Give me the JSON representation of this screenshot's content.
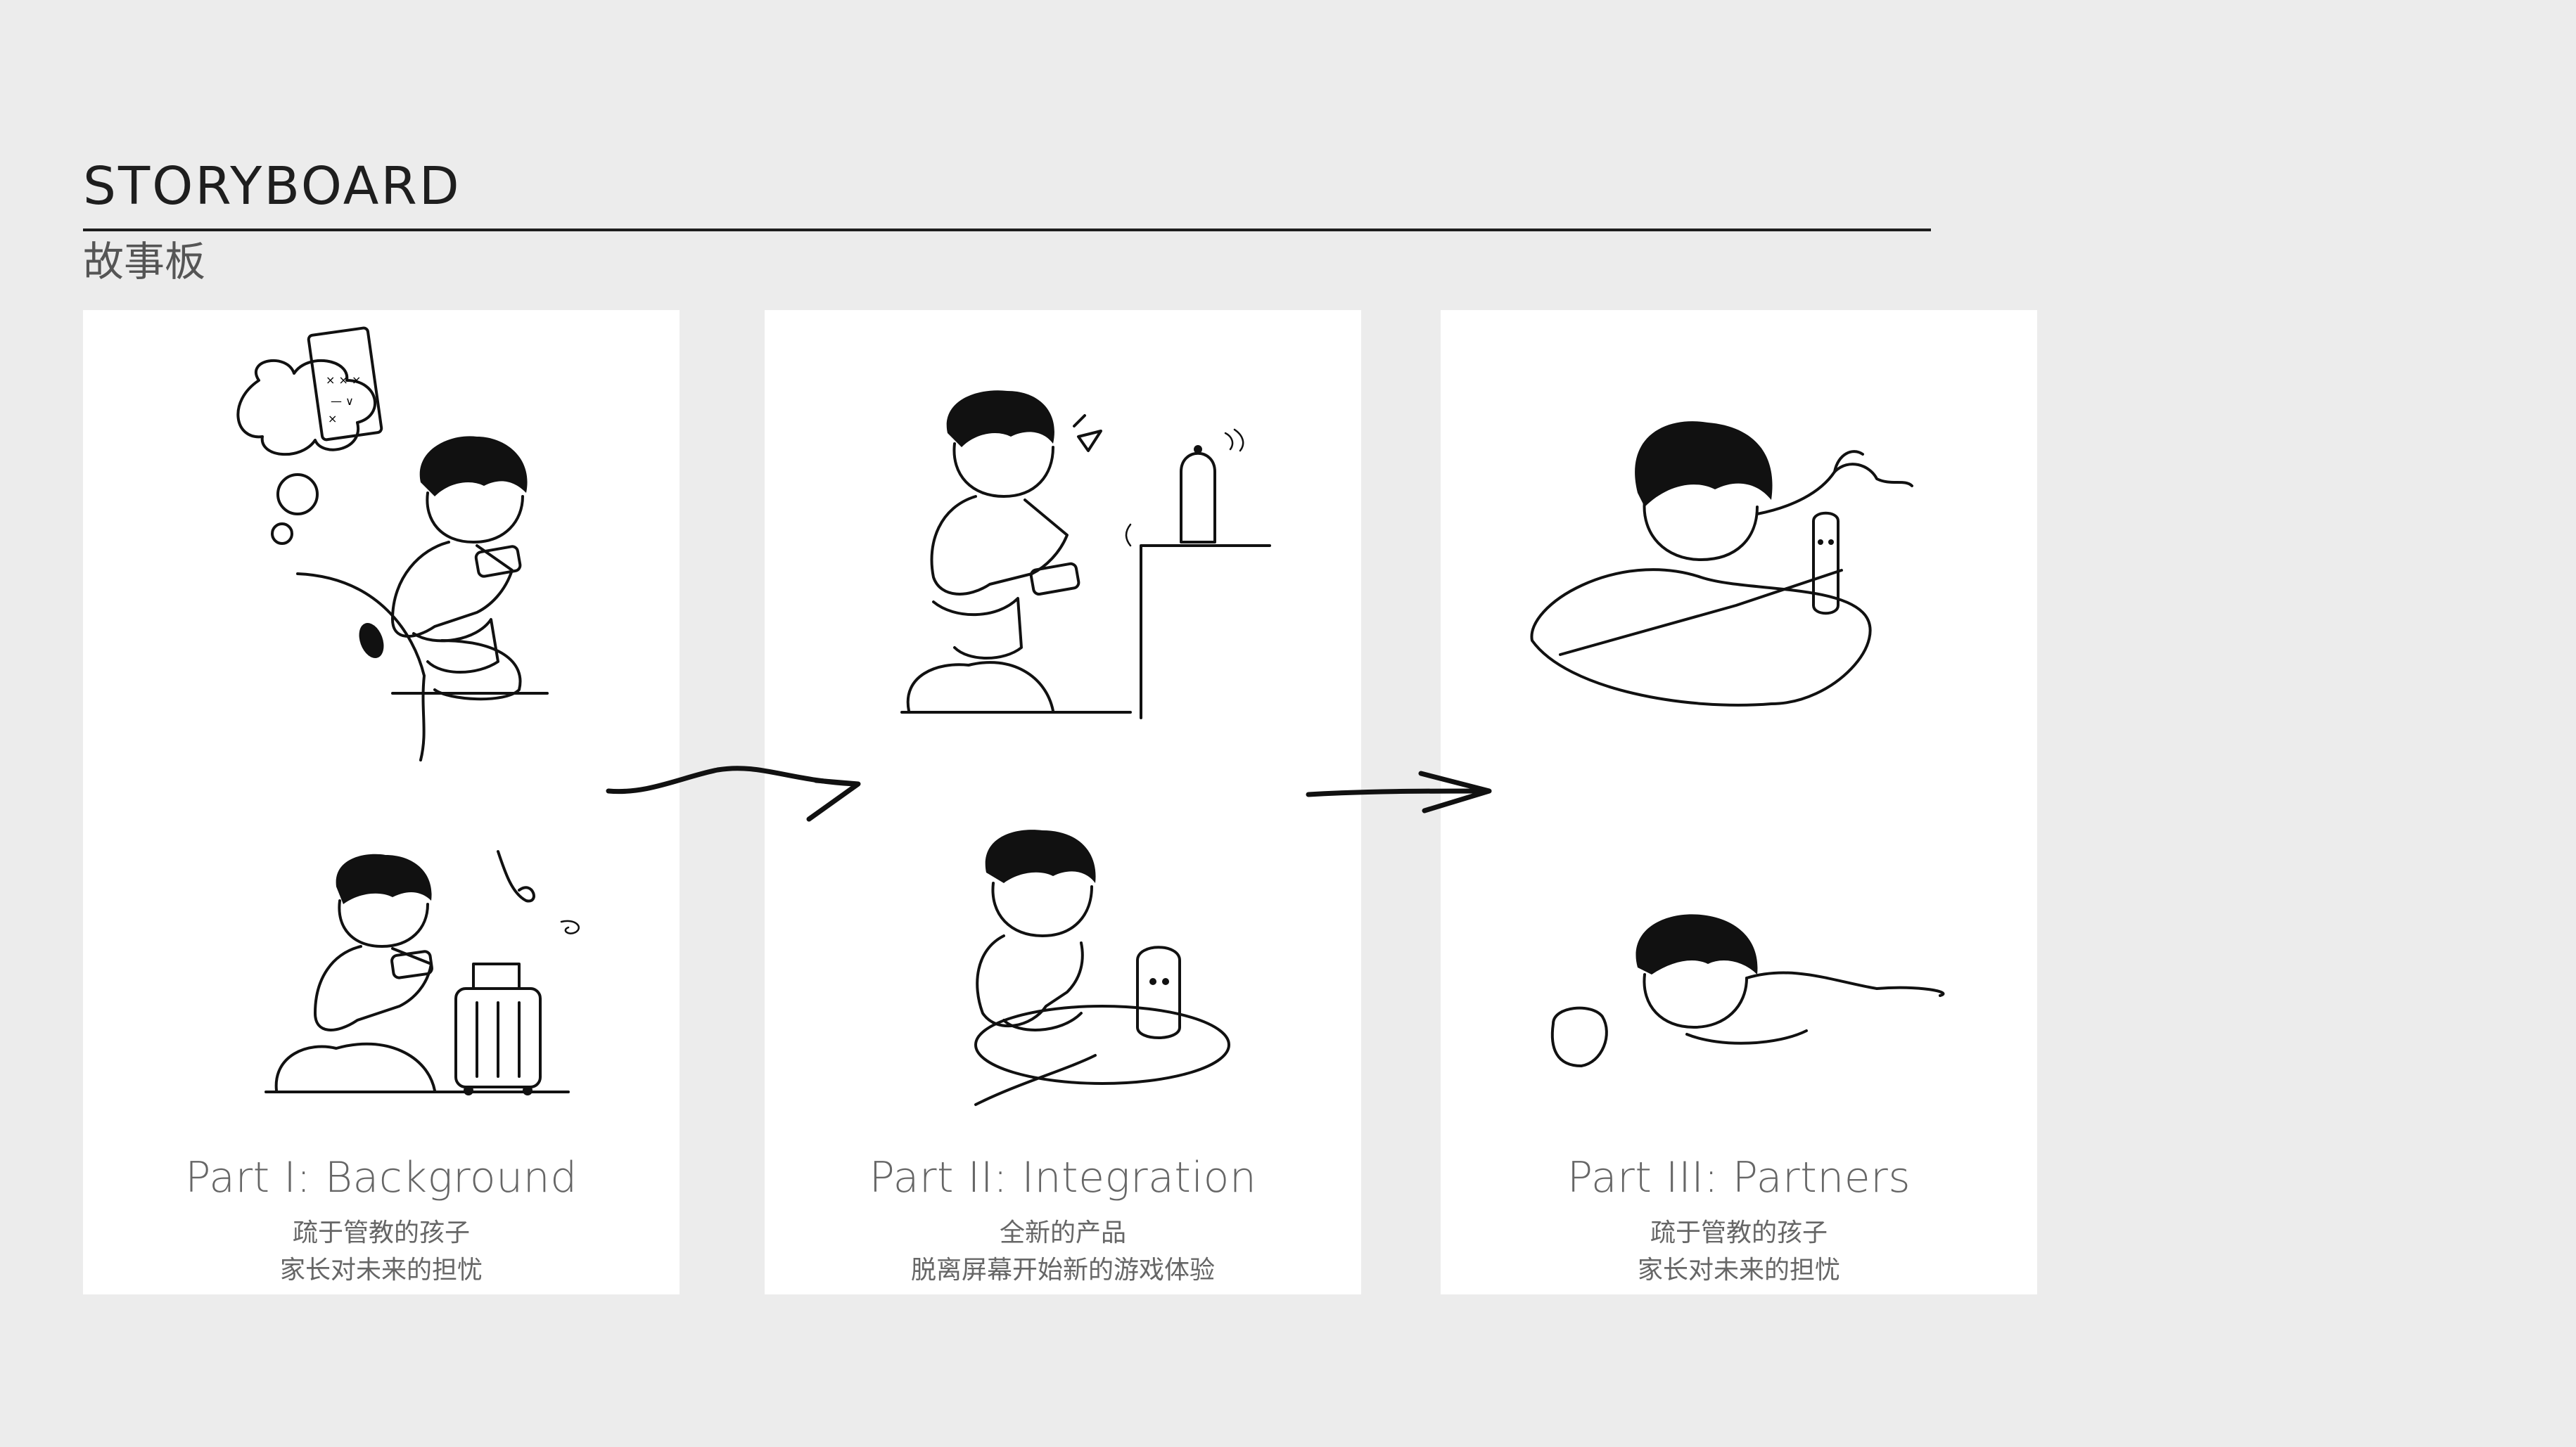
{
  "header": {
    "title": "STORYBOARD",
    "subtitle": "故事板"
  },
  "panels": [
    {
      "title": "Part I: Background",
      "lines": [
        "疏于管教的孩子",
        "家长对未来的担忧"
      ]
    },
    {
      "title": "Part II: Integration",
      "lines": [
        "全新的产品",
        "脱离屏幕开始新的游戏体验"
      ]
    },
    {
      "title": "Part III: Partners",
      "lines": [
        "疏于管教的孩子",
        "家长对未来的担忧"
      ]
    }
  ],
  "colors": {
    "background": "#ececec",
    "panel": "#ffffff",
    "ink": "#111111",
    "caption": "#666666"
  }
}
